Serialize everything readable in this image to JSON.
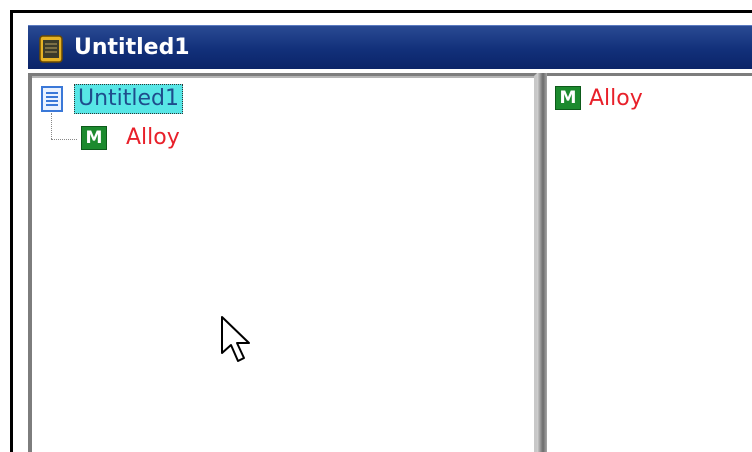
{
  "window": {
    "title": "Untitled1",
    "title_bar_color": "#12307a"
  },
  "tree": {
    "root": {
      "label": "Untitled1",
      "icon": "document-icon",
      "selected": true
    },
    "children": [
      {
        "label": "Alloy",
        "icon_letter": "M",
        "icon": "material-icon",
        "color": "#e8202a"
      }
    ]
  },
  "detail": {
    "items": [
      {
        "label": "Alloy",
        "icon_letter": "M",
        "icon": "material-icon",
        "color": "#e8202a"
      }
    ]
  },
  "cursor": {
    "icon": "mouse-pointer-icon"
  }
}
